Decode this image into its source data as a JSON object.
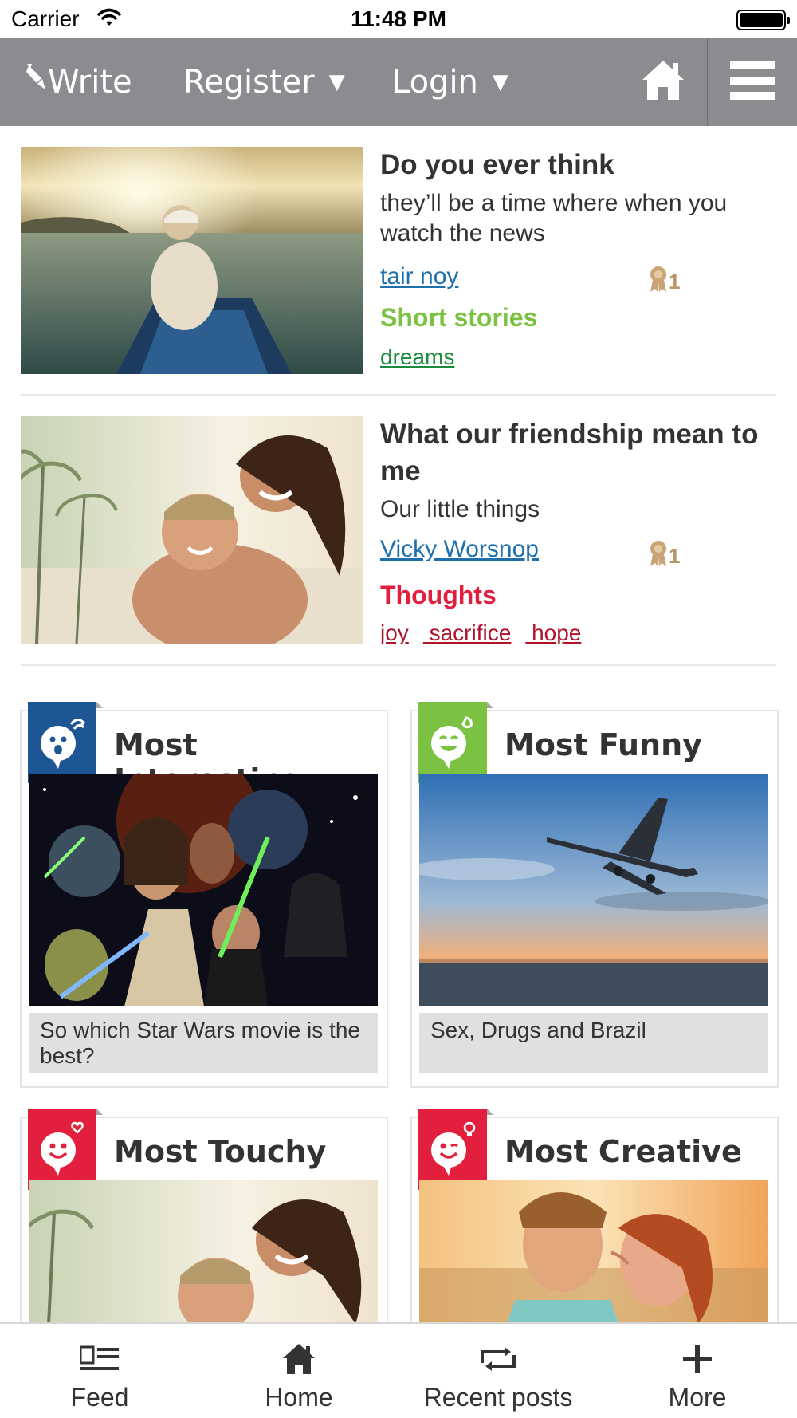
{
  "status_bar": {
    "carrier": "Carrier",
    "time": "11:48 PM"
  },
  "top_nav": {
    "write_label": "Write",
    "register_label": "Register",
    "login_label": "Login",
    "caret": "▼"
  },
  "posts": [
    {
      "title": "Do you ever think",
      "excerpt": "they’ll be a time where when you watch the news",
      "author": "tair noy",
      "awards": "1",
      "category": "Short stories",
      "category_color": "#7cc242",
      "tags": [
        "dreams"
      ],
      "tag_color": "#1a8c3c",
      "image": "woman-on-boat-sunset-photo"
    },
    {
      "title": "What our friendship mean to me",
      "excerpt": "Our little things",
      "author": "Vicky Worsnop",
      "awards": "1",
      "category": "Thoughts",
      "category_color": "#e21f3d",
      "tags": [
        "joy",
        "sacrifice",
        "hope"
      ],
      "tag_color": "#b0132a",
      "image": "couple-piggyback-beach-photo"
    }
  ],
  "cards": [
    {
      "title": "Most Interesting",
      "badge_color": "#1e5594",
      "caption": "So which Star Wars movie is the best?",
      "image": "star-wars-collage"
    },
    {
      "title": "Most Funny",
      "badge_color": "#7cc242",
      "caption": "Sex, Drugs and Brazil",
      "image": "airplane-sunset-sea"
    },
    {
      "title": "Most Touchy",
      "badge_color": "#e21f3d",
      "caption": "",
      "image": "couple-piggyback-beach-photo"
    },
    {
      "title": "Most Creative",
      "badge_color": "#e21f3d",
      "caption": "",
      "image": "couple-kissing-sunset"
    }
  ],
  "tab_bar": {
    "feed": "Feed",
    "home": "Home",
    "recent": "Recent posts",
    "more": "More"
  }
}
